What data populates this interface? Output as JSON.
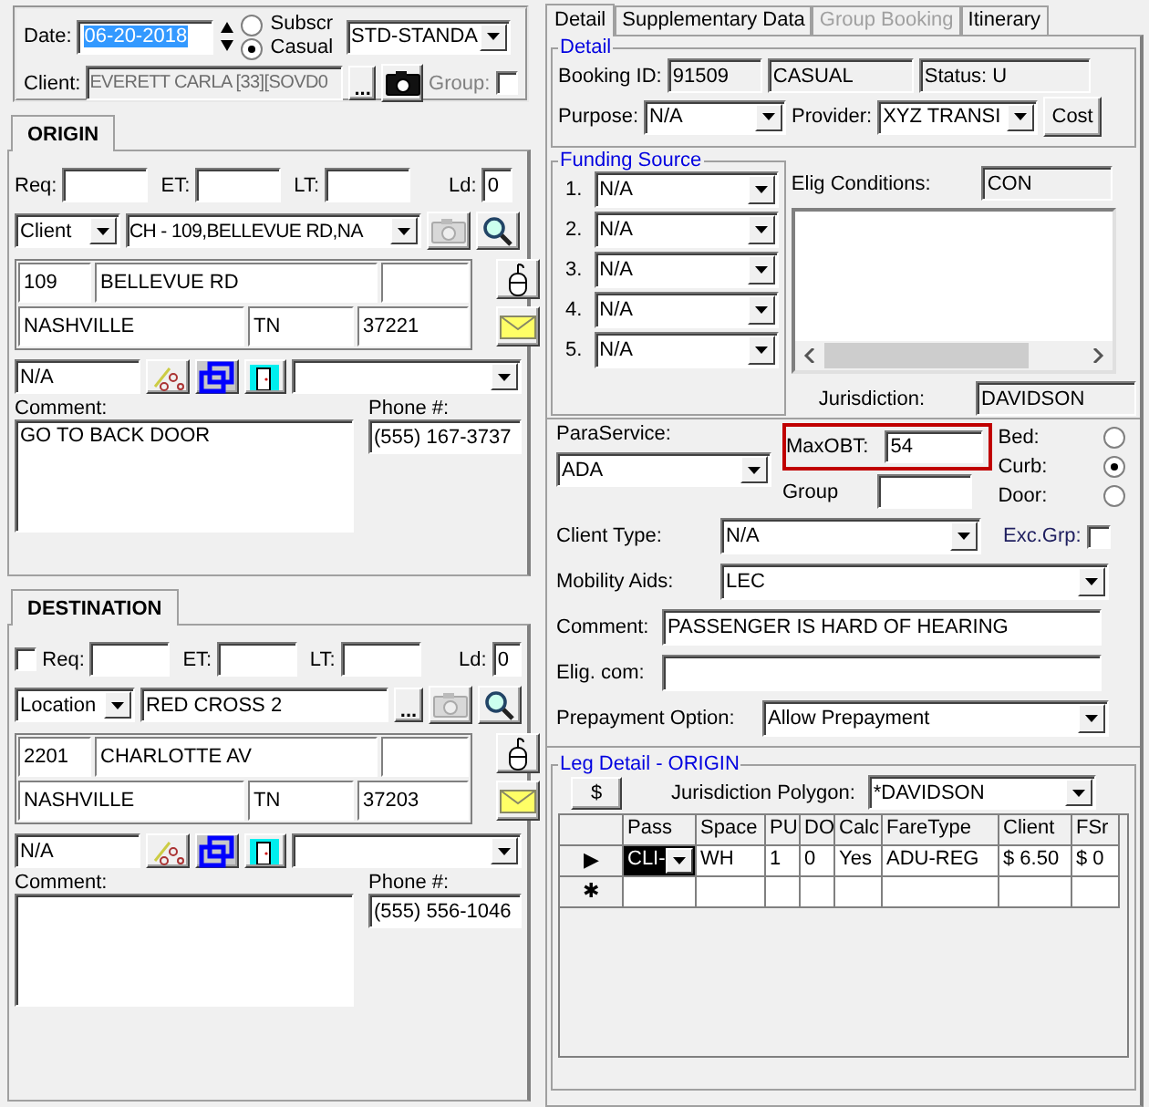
{
  "header": {
    "date_label": "Date:",
    "date": "06-20-2018",
    "client_type": [
      {
        "label": "Subscr",
        "selected": false
      },
      {
        "label": "Casual",
        "selected": true
      }
    ],
    "service": "STD-STANDA",
    "client_label": "Client:",
    "client": "EVERETT CARLA [33][SOVD0",
    "browse": "...",
    "group_label": "Group:",
    "group_checked": false
  },
  "stops": [
    {
      "tab": "ORIGIN",
      "req_label": "Req:",
      "et_label": "ET:",
      "lt_label": "LT:",
      "ld_label": "Ld:",
      "ld": "0",
      "source": "Client",
      "address_pick": "CH - 109,BELLEVUE RD,NA",
      "kind": "combo",
      "number": "109",
      "street": "BELLEVUE RD",
      "city": "NASHVILLE",
      "state": "TN",
      "zip": "37221",
      "zone": "N/A",
      "comment_label": "Comment:",
      "comment": "GO TO BACK DOOR",
      "phone_label": "Phone #:",
      "phone": "(555) 167-3737"
    },
    {
      "tab": "DESTINATION",
      "req_checked": false,
      "req_label": "Req:",
      "et_label": "ET:",
      "lt_label": "LT:",
      "ld_label": "Ld:",
      "ld": "0",
      "source": "Location",
      "address_pick": "RED CROSS 2",
      "kind": "browse",
      "browse": "...",
      "number": "2201",
      "street": "CHARLOTTE AV",
      "city": "NASHVILLE",
      "state": "TN",
      "zip": "37203",
      "zone": "N/A",
      "comment_label": "Comment:",
      "phone_label": "Phone #:",
      "phone": "(555) 556-1046"
    }
  ],
  "tabs": [
    {
      "label": "Detail",
      "selected": true,
      "disabled": false
    },
    {
      "label": "Supplementary Data",
      "selected": false,
      "disabled": false
    },
    {
      "label": "Group Booking",
      "selected": false,
      "disabled": true
    },
    {
      "label": "Itinerary",
      "selected": false,
      "disabled": false
    }
  ],
  "detail": {
    "legend": "Detail",
    "booking_label": "Booking ID:",
    "booking_id": "91509",
    "booking_type": "CASUAL",
    "status": "Status: U",
    "purpose_label": "Purpose:",
    "purpose": "N/A",
    "provider_label": "Provider:",
    "provider": "XYZ TRANSI",
    "cost": "Cost"
  },
  "funding": {
    "legend": "Funding Source",
    "items": [
      {
        "num": "1.",
        "value": "N/A"
      },
      {
        "num": "2.",
        "value": "N/A"
      },
      {
        "num": "3.",
        "value": "N/A"
      },
      {
        "num": "4.",
        "value": "N/A"
      },
      {
        "num": "5.",
        "value": "N/A"
      }
    ]
  },
  "elig": {
    "label": "Elig Conditions:",
    "value": "CON",
    "jurisdiction_label": "Jurisdiction:",
    "jurisdiction": "DAVIDSON"
  },
  "service": {
    "paraservice_label": "ParaService:",
    "paraservice": "ADA",
    "maxobt_label": "MaxOBT:",
    "maxobt": "54",
    "maxobt_highlight": true,
    "group_label": "Group",
    "positions": [
      {
        "label": "Bed:",
        "selected": false
      },
      {
        "label": "Curb:",
        "selected": true
      },
      {
        "label": "Door:",
        "selected": false
      }
    ],
    "exc_label": "Exc.Grp:",
    "exc_checked": false,
    "client_type_label": "Client Type:",
    "client_type": "N/A",
    "mobility_label": "Mobility Aids:",
    "mobility": "LEC",
    "comment_label": "Comment:",
    "comment": "PASSENGER IS HARD OF HEARING",
    "elig_com_label": "Elig. com:",
    "prepay_label": "Prepayment Option:",
    "prepay": "Allow Prepayment"
  },
  "leg": {
    "legend": "Leg Detail - ORIGIN",
    "fare_button": "$",
    "polygon_label": "Jurisdiction Polygon:",
    "polygon": "*DAVIDSON",
    "columns": [
      "Pass",
      "Space",
      "PU",
      "DO",
      "Calc",
      "FareType",
      "Client",
      "FSr"
    ],
    "rows": [
      {
        "indicator": "▶",
        "selected": true,
        "cells": [
          "CLI-",
          "WH",
          "1",
          "0",
          "Yes",
          "ADU-REG",
          "$ 6.50",
          "$ 0"
        ]
      }
    ],
    "new_row": "✱"
  }
}
